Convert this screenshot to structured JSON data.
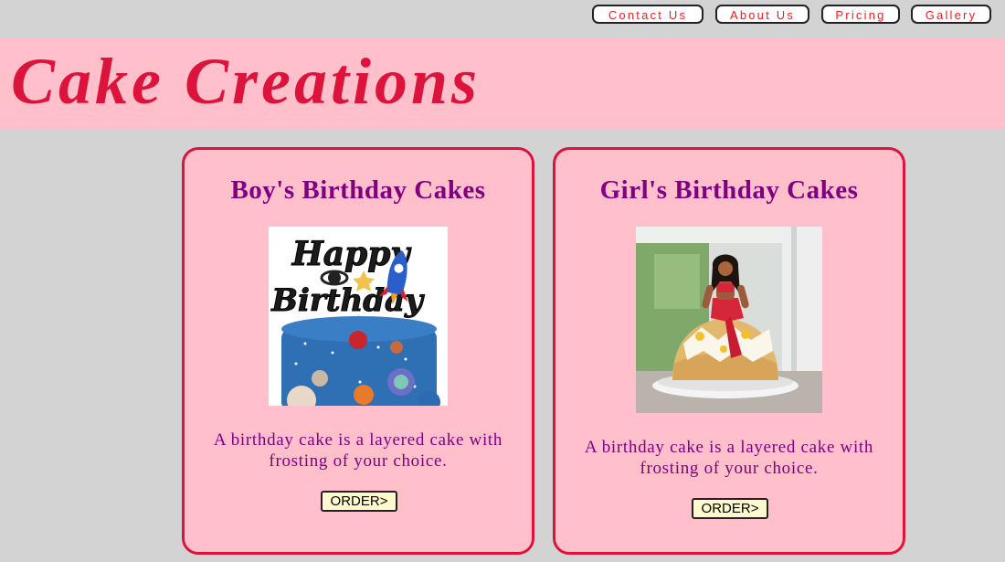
{
  "nav": {
    "items": [
      {
        "label": "Contact Us"
      },
      {
        "label": "About Us"
      },
      {
        "label": "Pricing"
      },
      {
        "label": "Gallery"
      }
    ]
  },
  "header": {
    "title": "Cake Creations"
  },
  "cards": [
    {
      "title": "Boy's Birthday Cakes",
      "description": "A birthday cake is a layered cake with frosting of your choice.",
      "button_label": "ORDER>",
      "topper_text": [
        "Happy",
        "Birthday"
      ]
    },
    {
      "title": "Girl's Birthday Cakes",
      "description": "A birthday cake is a layered cake with frosting of your choice.",
      "button_label": "ORDER>"
    }
  ],
  "colors": {
    "page_background": "#d3d3d3",
    "header_background": "#ffc0cb",
    "title_color": "#dc143c",
    "card_border": "#dc143c",
    "card_text": "#800080",
    "nav_text": "#ed1c24",
    "button_background": "#fffacd"
  }
}
